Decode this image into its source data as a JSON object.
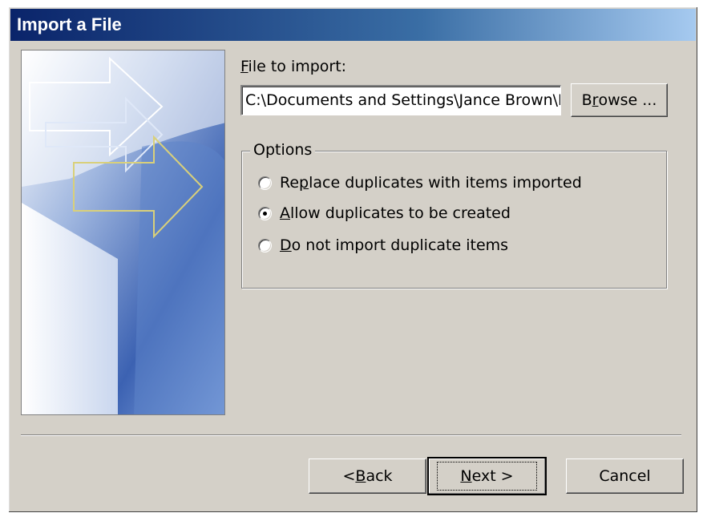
{
  "window": {
    "title": "Import a File"
  },
  "file": {
    "label_accel": "F",
    "label_rest": "ile to import:",
    "value": "C:\\Documents and Settings\\Jance Brown\\My Documents\\contacts.csv",
    "browse_pre": "B",
    "browse_accel": "r",
    "browse_post": "owse ..."
  },
  "options": {
    "legend": "Options",
    "items": [
      {
        "pre": "Re",
        "accel": "p",
        "post": "lace duplicates with items imported",
        "selected": false
      },
      {
        "pre": "",
        "accel": "A",
        "post": "llow duplicates to be created",
        "selected": true
      },
      {
        "pre": "",
        "accel": "D",
        "post": "o not import duplicate items",
        "selected": false
      }
    ]
  },
  "buttons": {
    "back_pre": "< ",
    "back_accel": "B",
    "back_post": "ack",
    "next_accel": "N",
    "next_post": "ext >",
    "cancel": "Cancel"
  },
  "colors": {
    "face": "#d4d0c8",
    "title_start": "#0a246a",
    "title_end": "#a6caf0"
  }
}
